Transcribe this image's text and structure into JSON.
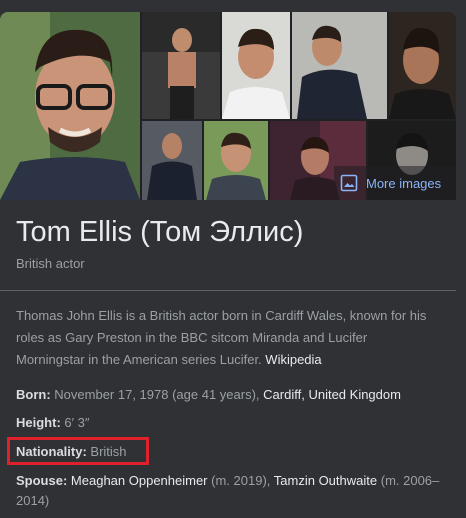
{
  "header": {
    "title": "Tom Ellis (Том Эллис)",
    "subtitle": "British actor",
    "more_images_label": "More images"
  },
  "description": {
    "text": "Thomas John Ellis is a British actor born in Cardiff Wales, known for his roles as Gary Preston in the BBC sitcom Miranda and Lucifer Morningstar in the American series Lucifer.",
    "source_link": "Wikipedia"
  },
  "facts": {
    "born": {
      "label": "Born:",
      "value": "November 17, 1978 (age 41 years),",
      "link1": "Cardiff,",
      "link2": "United Kingdom"
    },
    "height": {
      "label": "Height:",
      "value": "6′ 3″"
    },
    "nationality": {
      "label": "Nationality:",
      "value": "British"
    },
    "spouse": {
      "label": "Spouse:",
      "link1": "Meaghan Oppenheimer",
      "value1": "(m. 2019),",
      "link2": "Tamzin Outhwaite",
      "value2": "(m. 2006–2014)"
    }
  },
  "colors": {
    "background": "#303134",
    "accent_link": "#8ab4f8",
    "highlight": "#e0202a"
  }
}
